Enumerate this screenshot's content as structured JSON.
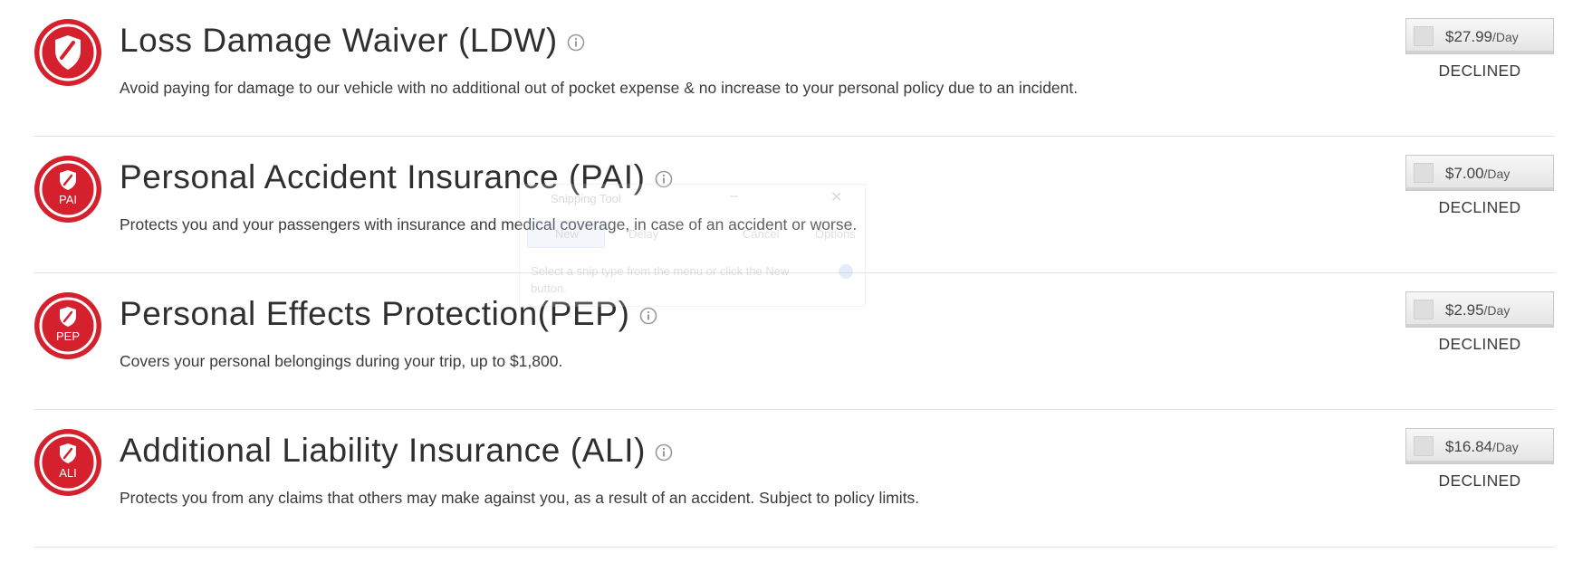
{
  "colors": {
    "brand_red": "#d5202e",
    "divider": "#e2e2e2"
  },
  "options": [
    {
      "title": "Loss Damage Waiver (LDW)",
      "badge_label": "",
      "badge_icon": "shield-check-icon",
      "description": "Avoid paying for damage to our vehicle with no additional out of pocket expense & no increase to your personal policy due to an incident.",
      "price": "$27.99",
      "unit": "/Day",
      "status": "DECLINED",
      "selected": false
    },
    {
      "title": "Personal Accident Insurance (PAI)",
      "badge_label": "PAI",
      "badge_icon": "shield-check-icon",
      "description": "Protects you and your passengers with insurance and medical coverage, in case of an accident or worse.",
      "price": "$7.00",
      "unit": "/Day",
      "status": "DECLINED",
      "selected": false
    },
    {
      "title": "Personal Effects Protection(PEP)",
      "badge_label": "PEP",
      "badge_icon": "shield-check-icon",
      "description": "Covers your personal belongings during your trip, up to $1,800.",
      "price": "$2.95",
      "unit": "/Day",
      "status": "DECLINED",
      "selected": false
    },
    {
      "title": "Additional Liability Insurance (ALI)",
      "badge_label": "ALI",
      "badge_icon": "shield-check-icon",
      "description": "Protects you from any claims that others may make against you, as a result of an accident. Subject to policy limits.",
      "price": "$16.84",
      "unit": "/Day",
      "status": "DECLINED",
      "selected": false
    }
  ],
  "snipping_tool_ghost": {
    "title": "Snipping Tool",
    "new_label": "New",
    "delay_label": "Delay",
    "cancel_label": "Cancel",
    "options_label": "Options",
    "message": "Select a snip type from the menu or click the New button."
  }
}
